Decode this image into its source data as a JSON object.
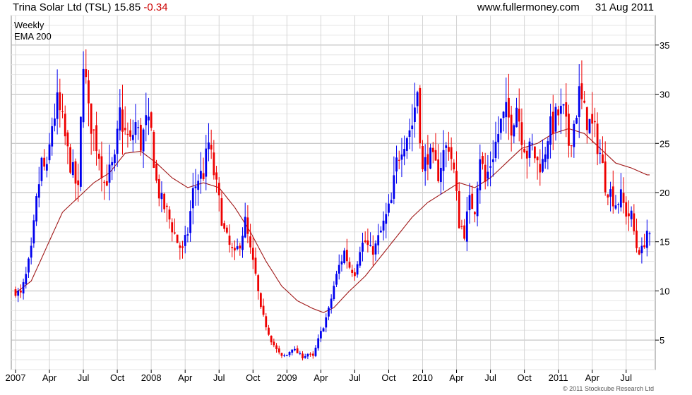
{
  "header": {
    "symbol": "Trina Solar Ltd (TSL)",
    "price": "15.85",
    "change": "-0.34",
    "site": "www.fullermoney.com",
    "date": "31 Aug 2011"
  },
  "legend": {
    "series1": "Weekly",
    "series2": "EMA 200"
  },
  "copyright": "© 2011 Stockcube Research Ltd",
  "colors": {
    "up": "#0000ee",
    "down": "#ee0000",
    "ema": "#a01818",
    "grid": "#cccccc"
  },
  "chart_data": {
    "type": "candlestick",
    "title": "Trina Solar Ltd (TSL)",
    "y_axis_side": "right",
    "ylim": [
      2,
      38
    ],
    "y_ticks": [
      5,
      10,
      15,
      20,
      25,
      30,
      35
    ],
    "x_ticks": [
      {
        "label": "2007",
        "w": 0
      },
      {
        "label": "Apr",
        "w": 13
      },
      {
        "label": "Jul",
        "w": 26
      },
      {
        "label": "Oct",
        "w": 39
      },
      {
        "label": "2008",
        "w": 52
      },
      {
        "label": "Apr",
        "w": 65
      },
      {
        "label": "Jul",
        "w": 78
      },
      {
        "label": "Oct",
        "w": 91
      },
      {
        "label": "2009",
        "w": 104
      },
      {
        "label": "Apr",
        "w": 117
      },
      {
        "label": "Jul",
        "w": 130
      },
      {
        "label": "Oct",
        "w": 143
      },
      {
        "label": "2010",
        "w": 156
      },
      {
        "label": "Apr",
        "w": 169
      },
      {
        "label": "Jul",
        "w": 182
      },
      {
        "label": "Oct",
        "w": 195
      },
      {
        "label": "2011",
        "w": 208
      },
      {
        "label": "Apr",
        "w": 221
      },
      {
        "label": "Jul",
        "w": 234
      }
    ],
    "close_anchors": [
      [
        0,
        10
      ],
      [
        2,
        9.6
      ],
      [
        4,
        11.5
      ],
      [
        6,
        14
      ],
      [
        8,
        19
      ],
      [
        10,
        23
      ],
      [
        12,
        22
      ],
      [
        14,
        27
      ],
      [
        16,
        29
      ],
      [
        18,
        27
      ],
      [
        20,
        24
      ],
      [
        22,
        22
      ],
      [
        24,
        20
      ],
      [
        26,
        34
      ],
      [
        28,
        28
      ],
      [
        30,
        26
      ],
      [
        32,
        24
      ],
      [
        34,
        21
      ],
      [
        36,
        22
      ],
      [
        38,
        23
      ],
      [
        40,
        28
      ],
      [
        42,
        26
      ],
      [
        44,
        25
      ],
      [
        46,
        27
      ],
      [
        48,
        25
      ],
      [
        50,
        27
      ],
      [
        52,
        26
      ],
      [
        54,
        21
      ],
      [
        56,
        19
      ],
      [
        58,
        18
      ],
      [
        60,
        16.5
      ],
      [
        62,
        15
      ],
      [
        64,
        14
      ],
      [
        66,
        16
      ],
      [
        68,
        20
      ],
      [
        70,
        21.5
      ],
      [
        72,
        22
      ],
      [
        74,
        25
      ],
      [
        76,
        22
      ],
      [
        78,
        19
      ],
      [
        80,
        16
      ],
      [
        82,
        14.5
      ],
      [
        84,
        13.5
      ],
      [
        86,
        15
      ],
      [
        88,
        17
      ],
      [
        90,
        14
      ],
      [
        92,
        11.5
      ],
      [
        94,
        8
      ],
      [
        96,
        6.5
      ],
      [
        98,
        5
      ],
      [
        100,
        4
      ],
      [
        102,
        3.3
      ],
      [
        104,
        3.5
      ],
      [
        106,
        4.2
      ],
      [
        108,
        3.7
      ],
      [
        110,
        3.3
      ],
      [
        112,
        3.6
      ],
      [
        114,
        3.3
      ],
      [
        116,
        5
      ],
      [
        118,
        6.5
      ],
      [
        120,
        8
      ],
      [
        122,
        10.5
      ],
      [
        124,
        12.5
      ],
      [
        126,
        14
      ],
      [
        128,
        12.5
      ],
      [
        130,
        12
      ],
      [
        132,
        14.5
      ],
      [
        134,
        15
      ],
      [
        136,
        14
      ],
      [
        138,
        14.5
      ],
      [
        140,
        16
      ],
      [
        142,
        17.5
      ],
      [
        144,
        19
      ],
      [
        146,
        23
      ],
      [
        148,
        25
      ],
      [
        150,
        26
      ],
      [
        152,
        27
      ],
      [
        154,
        30.5
      ],
      [
        156,
        22
      ],
      [
        158,
        24
      ],
      [
        160,
        23
      ],
      [
        162,
        22
      ],
      [
        164,
        24
      ],
      [
        166,
        25
      ],
      [
        168,
        22
      ],
      [
        170,
        17
      ],
      [
        172,
        16
      ],
      [
        174,
        19
      ],
      [
        176,
        18.5
      ],
      [
        178,
        24
      ],
      [
        180,
        21
      ],
      [
        182,
        23
      ],
      [
        184,
        25
      ],
      [
        186,
        27
      ],
      [
        188,
        28
      ],
      [
        190,
        27
      ],
      [
        192,
        29
      ],
      [
        194,
        26
      ],
      [
        196,
        24
      ],
      [
        198,
        24.5
      ],
      [
        200,
        23
      ],
      [
        202,
        23
      ],
      [
        204,
        26
      ],
      [
        206,
        27
      ],
      [
        208,
        28
      ],
      [
        210,
        28
      ],
      [
        212,
        25
      ],
      [
        214,
        27
      ],
      [
        216,
        30
      ],
      [
        218,
        28
      ],
      [
        220,
        27
      ],
      [
        222,
        26
      ],
      [
        224,
        24
      ],
      [
        226,
        21
      ],
      [
        228,
        20
      ],
      [
        230,
        19
      ],
      [
        232,
        19.5
      ],
      [
        234,
        18
      ],
      [
        236,
        17.5
      ],
      [
        238,
        14.5
      ],
      [
        240,
        14
      ],
      [
        242,
        16.2
      ]
    ],
    "ema_anchors": [
      [
        0,
        9.8
      ],
      [
        6,
        11
      ],
      [
        12,
        14.5
      ],
      [
        18,
        18
      ],
      [
        24,
        19.5
      ],
      [
        30,
        21
      ],
      [
        36,
        22
      ],
      [
        42,
        24
      ],
      [
        48,
        24.2
      ],
      [
        54,
        23
      ],
      [
        60,
        21.5
      ],
      [
        66,
        20.5
      ],
      [
        72,
        21
      ],
      [
        78,
        20.5
      ],
      [
        84,
        18.5
      ],
      [
        90,
        16
      ],
      [
        96,
        13
      ],
      [
        102,
        10.5
      ],
      [
        108,
        9
      ],
      [
        114,
        8.2
      ],
      [
        118,
        7.8
      ],
      [
        122,
        8.3
      ],
      [
        128,
        10
      ],
      [
        134,
        11.5
      ],
      [
        140,
        13.5
      ],
      [
        146,
        15.5
      ],
      [
        152,
        17.5
      ],
      [
        158,
        19
      ],
      [
        164,
        20
      ],
      [
        170,
        21
      ],
      [
        176,
        20.5
      ],
      [
        182,
        21.5
      ],
      [
        188,
        23
      ],
      [
        194,
        24.5
      ],
      [
        200,
        25
      ],
      [
        206,
        26
      ],
      [
        212,
        26.5
      ],
      [
        218,
        26
      ],
      [
        224,
        24.5
      ],
      [
        230,
        23
      ],
      [
        236,
        22.5
      ],
      [
        242,
        21.8
      ]
    ],
    "weeks": 244,
    "last_close": 15.85,
    "last_change": -0.34
  }
}
